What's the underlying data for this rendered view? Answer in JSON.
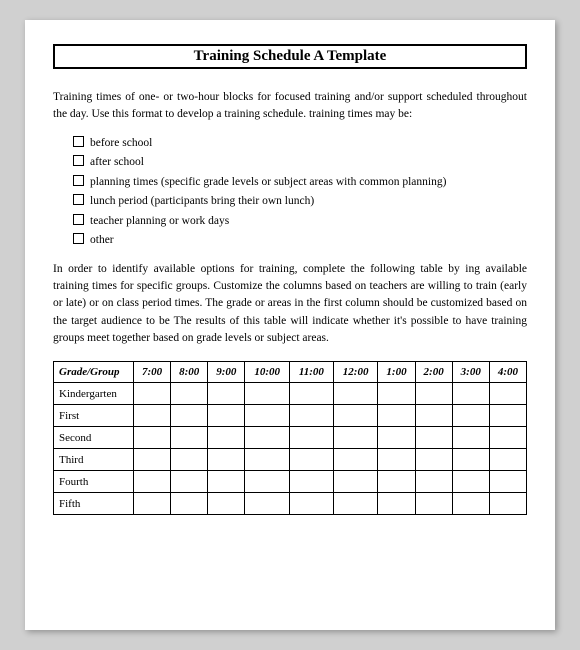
{
  "title": "Training Schedule A Template",
  "intro": "Training times of one- or two-hour blocks for focused training and/or support scheduled throughout the day. Use this format to develop a training schedule. training times may be:",
  "checklist": [
    "before school",
    "after school",
    "planning times (specific grade levels or subject areas with common planning)",
    "lunch period (participants bring their own lunch)",
    "teacher planning or work days",
    "other"
  ],
  "body_text": "In order to identify available options for training, complete the following table by ing available training times for specific groups. Customize the columns based on teachers are willing to train (early or late) or on class period times. The grade or areas in the first column should be customized based on the target audience to be The results of this table will indicate whether it's possible to have training groups meet together based on grade levels or subject areas.",
  "table": {
    "headers": [
      "Grade/Group",
      "7:00",
      "8:00",
      "9:00",
      "10:00",
      "11:00",
      "12:00",
      "1:00",
      "2:00",
      "3:00",
      "4:00"
    ],
    "rows": [
      [
        "Kindergarten"
      ],
      [
        "First"
      ],
      [
        "Second"
      ],
      [
        "Third"
      ],
      [
        "Fourth"
      ],
      [
        "Fifth"
      ]
    ]
  }
}
